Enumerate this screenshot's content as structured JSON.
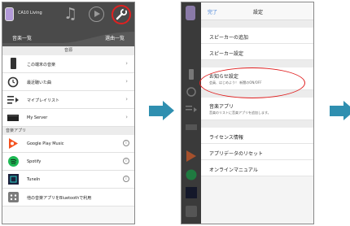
{
  "left_screen": {
    "device_name": "CA10 Living",
    "tabs": {
      "left": "音楽一覧",
      "right": "選曲一覧"
    },
    "section_title": "音源",
    "rows": [
      {
        "label": "この端末の音楽",
        "icon": "phone-icon"
      },
      {
        "label": "最近聴いた曲",
        "icon": "history-icon"
      },
      {
        "label": "マイプレイリスト",
        "icon": "playlist-icon"
      },
      {
        "label": "My Server",
        "icon": "server-icon"
      }
    ],
    "music_apps_header": "音楽アプリ",
    "apps": [
      {
        "label": "Google Play Music",
        "icon": "google-play-music-icon",
        "color": "#f4511e"
      },
      {
        "label": "Spotify",
        "icon": "spotify-icon",
        "color": "#1db954"
      },
      {
        "label": "TuneIn",
        "icon": "tunein-icon",
        "color": "#1c203c"
      },
      {
        "label": "他の音楽アプリをBluetoothで利用",
        "icon": "bluetooth-app-icon",
        "color": "#7b7b7b"
      }
    ]
  },
  "right_screen": {
    "done": "完了",
    "title": "設定",
    "items": [
      {
        "label": "スピーカーの追加"
      },
      {
        "label": "スピーカー設定"
      }
    ],
    "notification": {
      "label": "お知らせ設定",
      "sub": "会員、はじめよう！ 新聞のON/OFF"
    },
    "music_app": {
      "label": "音楽アプリ",
      "sub": "音楽のリストに音楽アプリを追加します。"
    },
    "bottom_items": [
      {
        "label": "ライセンス情報"
      },
      {
        "label": "アプリデータのリセット"
      },
      {
        "label": "オンラインマニュアル"
      }
    ]
  },
  "colors": {
    "highlight": "#e02020",
    "arrow": "#2f8fb0",
    "link": "#3b7bd6"
  }
}
